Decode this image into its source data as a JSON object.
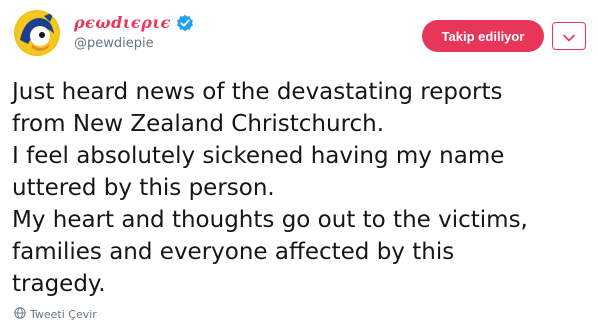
{
  "header": {
    "display_name": "ρєωdιєριє",
    "handle": "@pewdiepie",
    "follow_label": "Takip ediliyor",
    "verified_icon": "verified-badge-icon",
    "caret_icon": "chevron-down-icon"
  },
  "tweet": {
    "lines": [
      "Just heard news of the devastating reports",
      "from New Zealand Christchurch.",
      "I feel absolutely sickened having my name",
      "uttered by this person.",
      "My heart and thoughts go out to the victims,",
      "families and everyone affected by this",
      "tragedy."
    ]
  },
  "footer": {
    "translate_label": "Tweeti Çevir",
    "translate_icon": "globe-icon"
  },
  "colors": {
    "accent": "#e8365b",
    "verified": "#1da1f2",
    "muted": "#657786",
    "text": "#14171a"
  }
}
